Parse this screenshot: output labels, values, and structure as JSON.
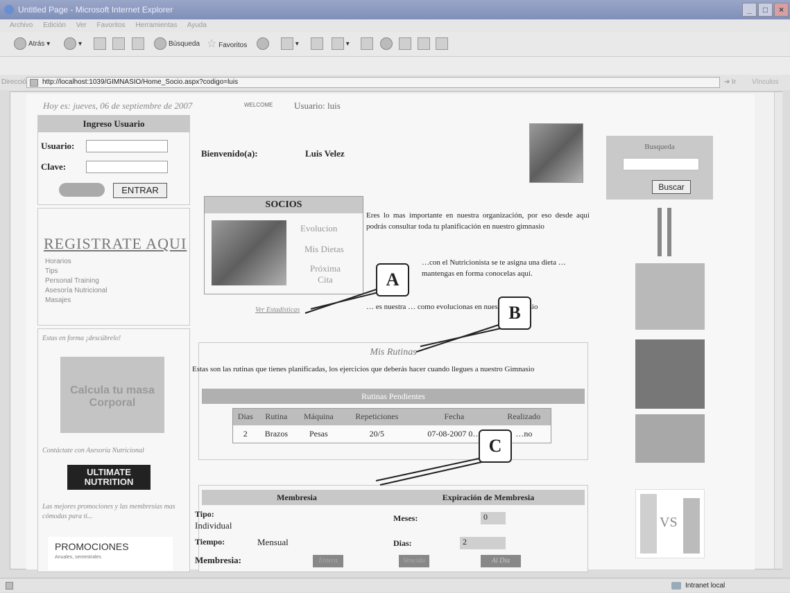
{
  "window": {
    "title": "Untitled Page - Microsoft Internet Explorer"
  },
  "menu": [
    "Archivo",
    "Edición",
    "Ver",
    "Favoritos",
    "Herramientas",
    "Ayuda"
  ],
  "toolbar": {
    "back": "Atrás",
    "search": "Búsqueda",
    "favorites": "Favoritos"
  },
  "address": {
    "label": "Dirección",
    "url": "http://localhost:1039/GIMNASIO/Home_Socio.aspx?codigo=luis",
    "go": "Ir",
    "links": "Vínculos"
  },
  "header": {
    "date_text": "Hoy es: jueves, 06 de septiembre de 2007",
    "welcome_badge": "WELCOME",
    "user_text": "Usuario: luis"
  },
  "login": {
    "title": "Ingreso Usuario",
    "user_label": "Usuario:",
    "pass_label": "Clave:",
    "enter_button": "ENTRAR"
  },
  "left_nav": {
    "register": "REGISTRATE AQUI",
    "items": [
      "Horarios",
      "Tips",
      "Personal Training",
      "Asesoría Nutricional",
      "Masajes"
    ]
  },
  "left_promos": {
    "caption1": "Estas en forma ¡descúbrelo!",
    "image1_text": "Calcula tu masa Corporal",
    "caption2": "Contáctate con Asesoría Nutricional",
    "brand_logo": "ULTIMATE NUTRITION",
    "caption3": "Las mejores promociones y las membresías mas cómodas para ti...",
    "promo_title": "PROMOCIONES",
    "promo_sub": "Anuales, semestrales"
  },
  "main": {
    "welcome_label": "Bienvenido(a):",
    "member_name": "Luis Velez",
    "socios": {
      "title": "SOCIOS",
      "links": [
        "Evolucion",
        "Mis Dietas",
        "Próxima Cita"
      ],
      "stats_link": "Ver Estadísticas"
    },
    "intro_text": "Eres lo mas importante en nuestra organización, por eso desde aquí podrás consultar toda tu planificación en nuestro gimnasio",
    "intro_text2": "…con el Nutricionista se te asigna una dieta …mantengas en forma conocelas aquí.",
    "intro_text3": "… es nuestra … como evolucionas en nuestro Gimnasio",
    "rutinas": {
      "title": "Mis Rutinas",
      "description": "Estas son las rutinas que tienes planificadas, los ejercicios que deberás hacer cuando llegues a nuestro Gimnasio",
      "pending_header": "Rutinas Pendientes",
      "columns": [
        "Dias",
        "Rutina",
        "Máquina",
        "Repeticiones",
        "Fecha",
        "Realizado"
      ],
      "rows": [
        [
          "2",
          "Brazos",
          "Pesas",
          "20/5",
          "07-08-2007 0…",
          "…no"
        ]
      ]
    },
    "membresia": {
      "header_left": "Membresia",
      "header_right": "Expiración de Membresia",
      "tipo_label": "Tipo:",
      "tipo_value": "Individual",
      "tiempo_label": "Tiempo:",
      "tiempo_value": "Mensual",
      "meses_label": "Meses:",
      "meses_value": "0",
      "dias_label": "Dias:",
      "dias_value": "2",
      "membresia_label": "Membresia:",
      "tags": [
        "Entera",
        "Vencida",
        "Al Día"
      ]
    }
  },
  "right": {
    "search_title": "Busqueda",
    "search_button": "Buscar",
    "vs_text": "VS"
  },
  "callouts": [
    "A",
    "B",
    "C"
  ],
  "status": {
    "zone": "Intranet local"
  }
}
